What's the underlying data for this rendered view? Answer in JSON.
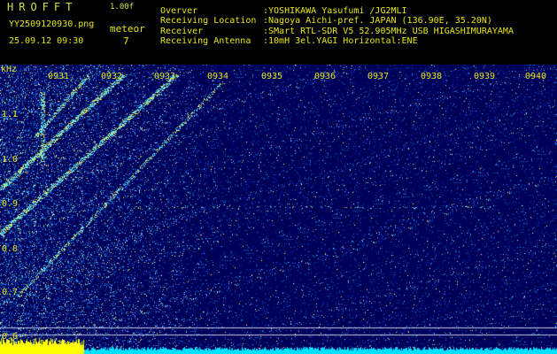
{
  "header": {
    "app_title": "HROFFT",
    "version": "1.00f",
    "filename": "YY2509120930.png",
    "datetime": "25.09.12 09:30",
    "detect_label": "meteor",
    "detect_count": "7"
  },
  "station_info": [
    {
      "key": "Overver",
      "value": ":YOSHIKAWA Yasufumi /JG2MLI"
    },
    {
      "key": "Receiving Location",
      "value": ":Nagoya Aichi-pref. JAPAN (136.90E, 35.20N)"
    },
    {
      "key": "Receiver",
      "value": ":SMart RTL-SDR V5 52.905MHz USB HIGASHIMURAYAMA"
    },
    {
      "key": "Receiving Antenna",
      "value": ":10mH 3el.YAGI Horizontal:ENE"
    }
  ],
  "spectrogram": {
    "unit_label": "kHz",
    "y_ticks": [
      "1.1",
      "1.0",
      "0.9",
      "0.8",
      "0.7",
      "0.6"
    ],
    "time_ticks": [
      "0931",
      "0932",
      "0933",
      "0934",
      "0935",
      "0936",
      "0937",
      "0938",
      "0939",
      "0940"
    ],
    "colors": {
      "background": "#000066",
      "text": "#e6e61a",
      "power_high": "#ffff00",
      "power_low": "#00e0ff"
    }
  }
}
